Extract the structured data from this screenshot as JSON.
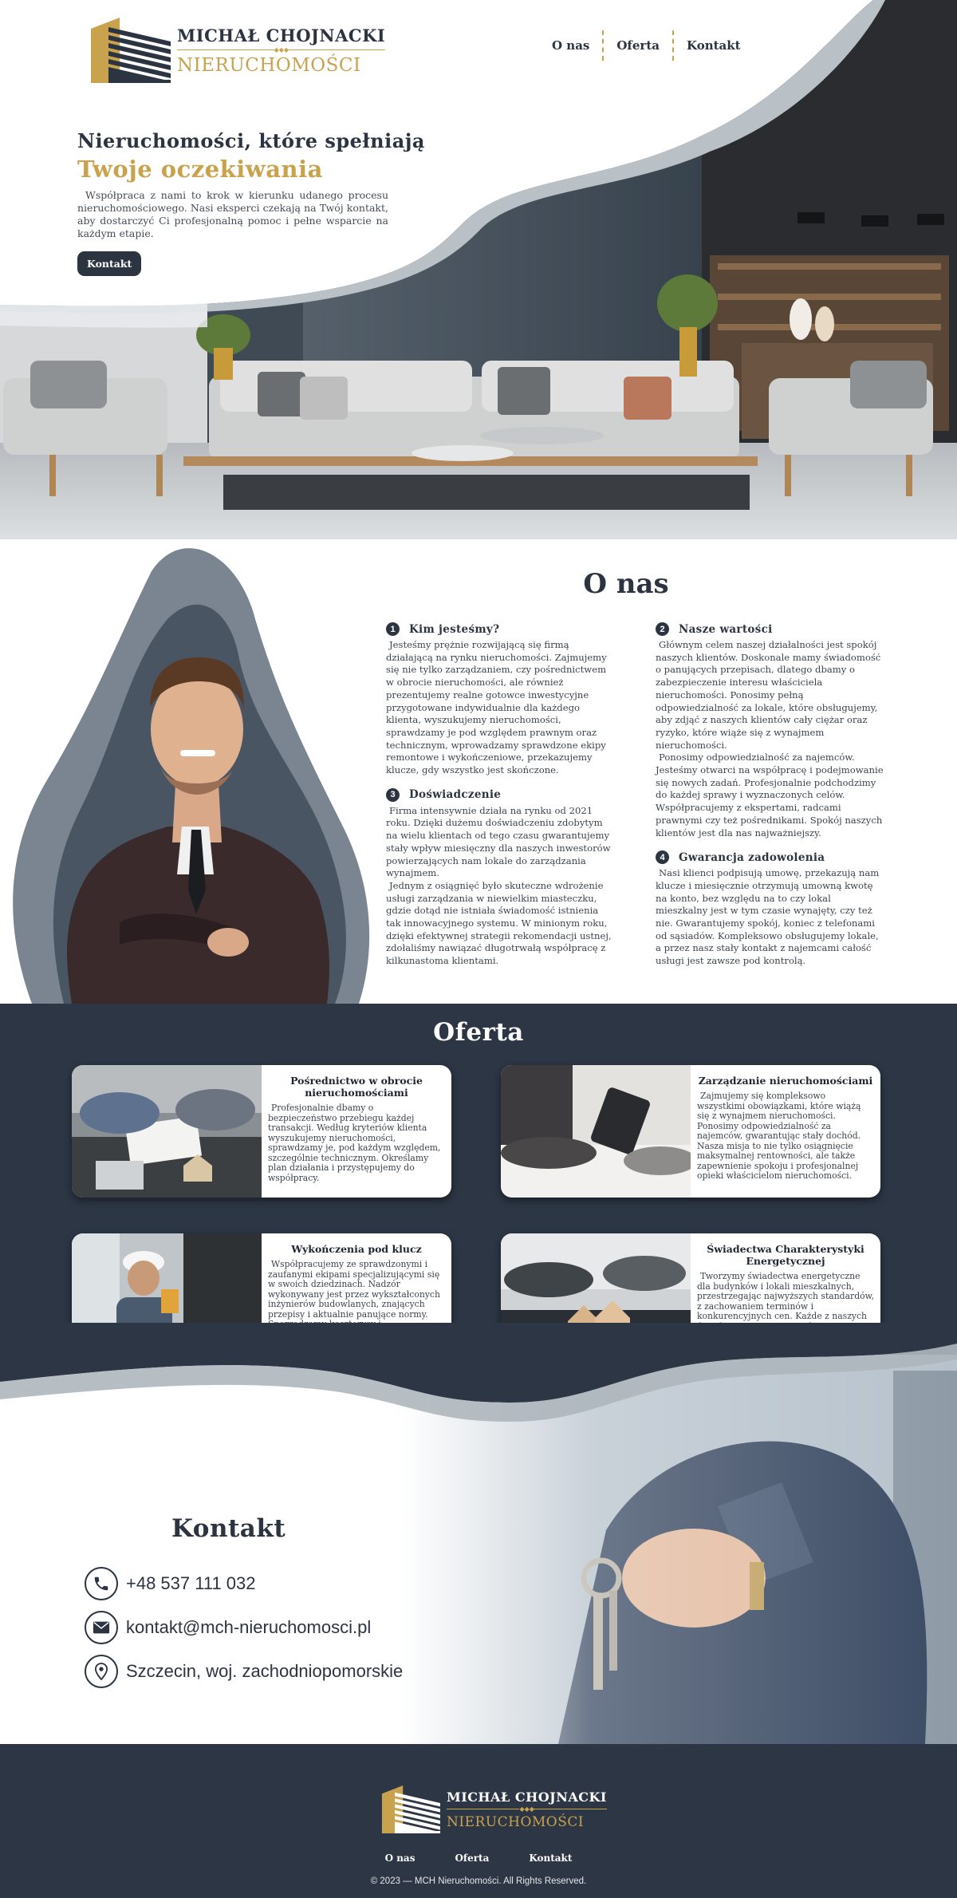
{
  "brand": {
    "line1": "MICHAŁ CHOJNACKI",
    "line2": "NIERUCHOMOŚCI"
  },
  "nav": {
    "items": [
      "O nas",
      "Oferta",
      "Kontakt"
    ]
  },
  "hero": {
    "title_line1": "Nieruchomości, które spełniają",
    "title_line2": "Twoje oczekiwania",
    "description": "Współpraca z nami to krok w kierunku udanego procesu nieruchomościowego. Nasi eksperci czekają na Twój kontakt, aby dostarczyć Ci profesjonalną pomoc i pełne wsparcie na każdym etapie.",
    "button": "Kontakt"
  },
  "about": {
    "title": "O nas",
    "blocks": [
      {
        "num": "1",
        "title": "Kim jesteśmy?",
        "paragraphs": [
          "Jesteśmy prężnie rozwijającą się firmą działającą na rynku nieruchomości. Zajmujemy się nie tylko zarządzaniem, czy pośrednictwem w obrocie nieruchomości, ale również prezentujemy realne gotowce inwestycyjne przygotowane indywidualnie dla każdego klienta, wyszukujemy nieruchomości, sprawdzamy je pod względem prawnym oraz technicznym, wprowadzamy sprawdzone ekipy remontowe i wykończeniowe, przekazujemy klucze, gdy wszystko jest skończone."
        ]
      },
      {
        "num": "3",
        "title": "Doświadczenie",
        "paragraphs": [
          "Firma intensywnie działa na rynku od 2021 roku. Dzięki dużemu doświadczeniu zdobytym na wielu klientach od tego czasu gwarantujemy stały wpływ miesięczny dla naszych inwestorów powierzających nam lokale do zarządzania wynajmem.",
          "Jednym z osiągnięć było skuteczne wdrożenie usługi zarządzania w niewielkim miasteczku, gdzie dotąd nie istniała świadomość istnienia tak innowacyjnego systemu. W minionym roku, dzięki efektywnej strategii rekomendacji ustnej, zdołaliśmy nawiązać długotrwałą współpracę z kilkunastoma klientami."
        ]
      },
      {
        "num": "2",
        "title": "Nasze wartości",
        "paragraphs": [
          "Głównym celem naszej działalności jest spokój naszych klientów. Doskonale mamy świadomość o panujących przepisach, dlatego dbamy o zabezpieczenie interesu właściciela nieruchomości. Ponosimy pełną odpowiedzialność za lokale, które obsługujemy, aby zdjąć z naszych klientów cały ciężar oraz ryzyko, które wiąże się z wynajmem nieruchomości.",
          "Ponosimy odpowiedzialność za najemców. Jesteśmy otwarci na współpracę i podejmowanie się nowych zadań. Profesjonalnie podchodzimy do każdej sprawy i wyznaczonych celów. Współpracujemy z ekspertami, radcami prawnymi czy też pośrednikami. Spokój naszych klientów jest dla nas najważniejszy."
        ]
      },
      {
        "num": "4",
        "title": "Gwarancja zadowolenia",
        "paragraphs": [
          "Nasi klienci podpisują umowę, przekazują nam klucze i miesięcznie otrzymują umowną kwotę na konto, bez względu na to czy lokal mieszkalny jest w tym czasie wynajęty, czy też nie. Gwarantujemy spokój, koniec z telefonami od sąsiadów. Kompleksowo obsługujemy lokale, a przez nasz stały kontakt z najemcami całość usługi jest zawsze pod kontrolą."
        ]
      }
    ]
  },
  "offer": {
    "title": "Oferta",
    "cards": [
      {
        "title": "Pośrednictwo w obrocie nieruchomościami",
        "description": "Profesjonalnie dbamy o bezpieczeństwo przebiegu każdej transakcji. Według kryteriów klienta wyszukujemy nieruchomości, sprawdzamy je, pod każdym względem, szczególnie technicznym. Określamy plan działania i przystępujemy do współpracy.",
        "image": "signing-documents-photo"
      },
      {
        "title": "Zarządzanie nieruchomościami",
        "description": "Zajmujemy się kompleksowo wszystkimi obowiązkami, które wiążą się z wynajmem nieruchomości. Ponosimy odpowiedzialność za najemców, gwarantując stały dochód. Nasza misja to nie tylko osiągnięcie maksymalnej rentowności, ale także zapewnienie spokoju i profesjonalnej opieki właścicielom nieruchomości.",
        "image": "tablet-meeting-photo"
      },
      {
        "title": "Wykończenia pod klucz",
        "description": "Współpracujemy ze sprawdzonymi i zaufanymi ekipami specjalizującymi się w swoich dziedzinach. Nadzór wykonywany jest przez wykształconych inżynierów budowlanych, znających przepisy i aktualnie panujące normy. Sporządzamy kosztorysy i harmonogramy, aby jasno określić cel i czas trwania prac.",
        "image": "construction-worker-photo"
      },
      {
        "title": "Świadectwa Charakterystyki Energetycznej",
        "description": "Tworzymy świadectwa energetyczne dla budynków i lokali mieszkalnych, przestrzegając najwyższych standardów, z zachowaniem terminów i konkurencyjnych cen. Każde z naszych świadectw energetycznych jest zarejestrowane w centralnym rejestrze charakterystyki energetycznej budynków.",
        "image": "house-models-photo"
      }
    ]
  },
  "contact": {
    "title": "Kontakt",
    "phone": "+48 537 111 032",
    "email": "kontakt@mch-nieruchomosci.pl",
    "address": "Szczecin, woj. zachodniopomorskie"
  },
  "footer": {
    "nav": [
      "O nas",
      "Oferta",
      "Kontakt"
    ],
    "copyright": "© 2023 — MCH Nieruchomości.  All Rights Reserved."
  },
  "colors": {
    "navy": "#2c3645",
    "gold": "#c9a24e",
    "slate": "#7b8591",
    "light_gray": "#b4bbc2"
  },
  "icons": {
    "phone": "phone-icon",
    "email": "envelope-icon",
    "address": "location-pin-icon"
  }
}
